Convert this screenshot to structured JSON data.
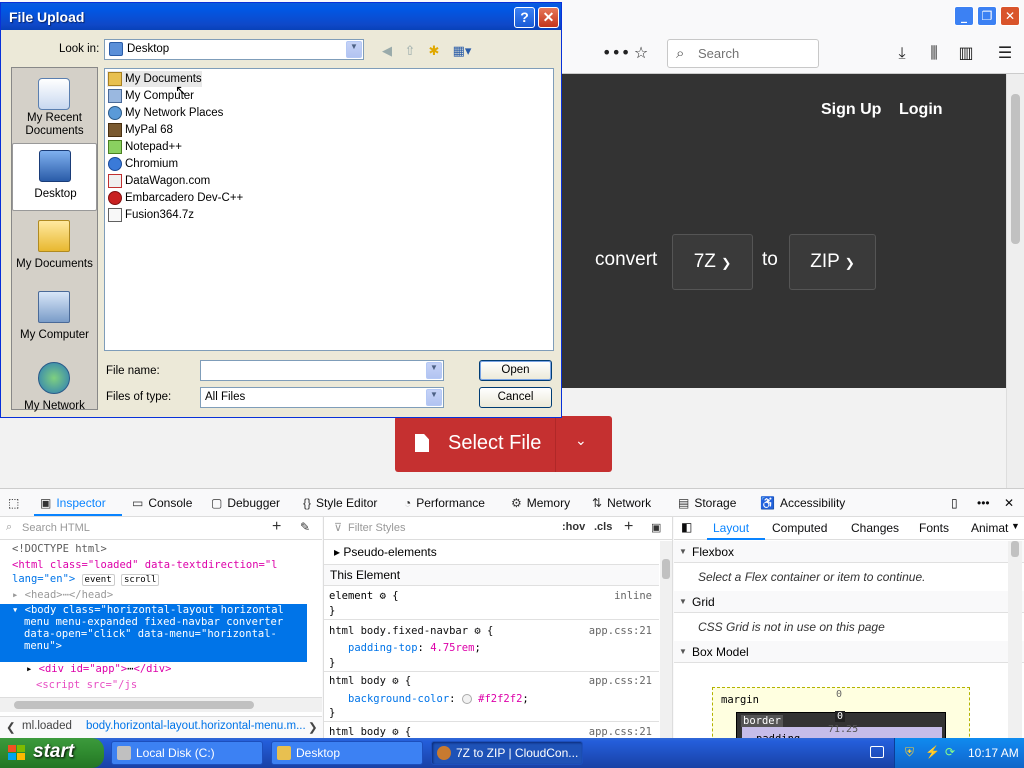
{
  "browser": {
    "search_placeholder": "Search",
    "nav": {
      "signup": "Sign Up",
      "login": "Login"
    },
    "converter": {
      "convert_label": "convert",
      "to_label": "to",
      "from_format": "7Z",
      "to_format": "ZIP",
      "select_file": "Select File"
    }
  },
  "devtools": {
    "tabs": [
      "Inspector",
      "Console",
      "Debugger",
      "Style Editor",
      "Performance",
      "Memory",
      "Network",
      "Storage",
      "Accessibility"
    ],
    "search_html_placeholder": "Search HTML",
    "filter_styles_placeholder": "Filter Styles",
    "hov": ":hov",
    "cls": ".cls",
    "right_tabs": [
      "Layout",
      "Computed",
      "Changes",
      "Fonts",
      "Animat"
    ],
    "markup": {
      "doctype": "<!DOCTYPE html>",
      "html_open": "<html class=\"loaded\" data-textdirection=\"l",
      "html_lang": "lang=\"en\">",
      "event_badge": "event",
      "scroll_badge": "scroll",
      "head": "<head>",
      "head_close": "</head>",
      "body_1": "<body class=\"horizontal-layout horizontal",
      "body_2": "menu menu-expanded fixed-navbar converter",
      "body_3": "data-open=\"click\" data-menu=\"horizontal-",
      "body_4": "menu\">",
      "div_app": "<div id=\"app\">",
      "div_close": "</div>",
      "script": "<script src=\"/js"
    },
    "breadcrumb": {
      "part1": "ml.loaded",
      "part2": "body.horizontal-layout.horizontal-menu.m..."
    },
    "rules": {
      "pseudo": "Pseudo-elements",
      "this_element": "This Element",
      "element_sel": "element",
      "inline": "inline",
      "rule1_sel": "html body.fixed-navbar",
      "rule1_src": "app.css:21",
      "rule1_prop": "padding-top",
      "rule1_val": "4.75rem",
      "rule2_sel": "html body",
      "rule2_src": "app.css:21",
      "rule2_prop": "background-color",
      "rule2_val": "#f2f2f2",
      "rule3_sel": "html body",
      "rule3_src": "app.css:21"
    },
    "layout": {
      "flexbox": "Flexbox",
      "flex_msg": "Select a Flex container or item to continue.",
      "grid": "Grid",
      "grid_msg": "CSS Grid is not in use on this page",
      "box_model": "Box Model",
      "margin": "margin",
      "border": "border",
      "padding": "padding",
      "margin_top": "0",
      "border_top": "0",
      "padding_top": "71.25"
    }
  },
  "dialog": {
    "title": "File Upload",
    "help": "?",
    "look_in_label": "Look in:",
    "look_in_value": "Desktop",
    "places": [
      "My Recent Documents",
      "Desktop",
      "My Documents",
      "My Computer",
      "My Network"
    ],
    "files": [
      "My Documents",
      "My Computer",
      "My Network Places",
      "MyPal 68",
      "Notepad++",
      "Chromium",
      "DataWagon.com",
      "Embarcadero Dev-C++",
      "Fusion364.7z"
    ],
    "file_name_label": "File name:",
    "file_name_value": "",
    "files_of_type_label": "Files of type:",
    "files_of_type_value": "All Files",
    "open": "Open",
    "cancel": "Cancel"
  },
  "taskbar": {
    "start": "start",
    "tasks": [
      "Local Disk (C:)",
      "Desktop",
      "7Z to ZIP | CloudCon..."
    ],
    "clock": "10:17 AM"
  }
}
